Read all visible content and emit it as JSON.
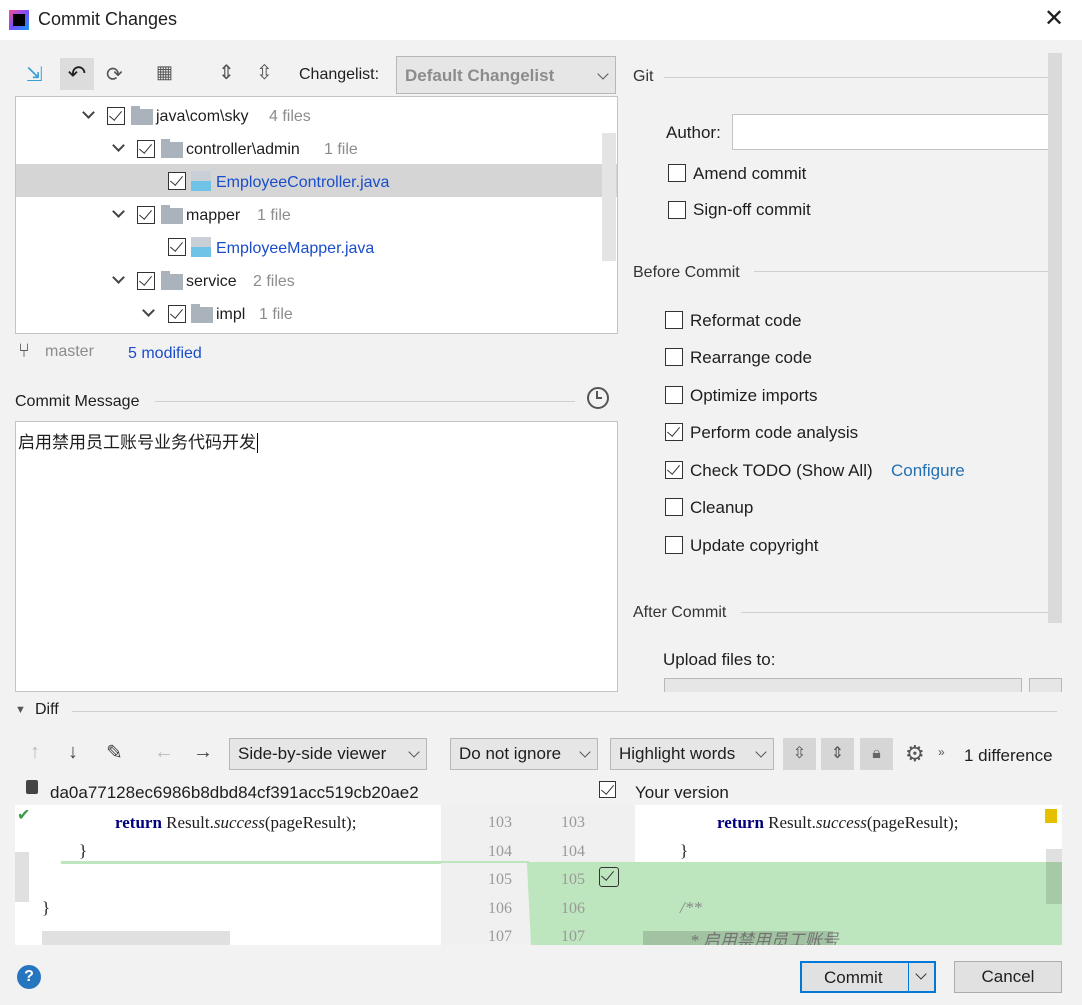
{
  "window": {
    "title": "Commit Changes"
  },
  "toolbar": {
    "changelist_label": "Changelist:",
    "changelist_value": "Default Changelist"
  },
  "tree": {
    "rows": [
      {
        "name": "java\\com\\sky",
        "count": "4 files",
        "type": "folder"
      },
      {
        "name": "controller\\admin",
        "count": "1 file",
        "type": "folder"
      },
      {
        "name": "EmployeeController.java",
        "type": "file",
        "selected": true
      },
      {
        "name": "mapper",
        "count": "1 file",
        "type": "folder"
      },
      {
        "name": "EmployeeMapper.java",
        "type": "file"
      },
      {
        "name": "service",
        "count": "2 files",
        "type": "folder"
      },
      {
        "name": "impl",
        "count": "1 file",
        "type": "folder"
      }
    ]
  },
  "status": {
    "branch": "master",
    "modified": "5 modified"
  },
  "commit_message": {
    "label": "Commit Message",
    "value": "启用禁用员工账号业务代码开发"
  },
  "git": {
    "title": "Git",
    "author_label": "Author:",
    "author_value": "",
    "amend": "Amend commit",
    "signoff": "Sign-off commit"
  },
  "before_commit": {
    "title": "Before Commit",
    "options": [
      {
        "label": "Reformat code",
        "checked": false
      },
      {
        "label": "Rearrange code",
        "checked": false
      },
      {
        "label": "Optimize imports",
        "checked": false
      },
      {
        "label": "Perform code analysis",
        "checked": true
      },
      {
        "label": "Check TODO (Show All)",
        "checked": true,
        "link": "Configure"
      },
      {
        "label": "Cleanup",
        "checked": false
      },
      {
        "label": "Update copyright",
        "checked": false
      }
    ]
  },
  "after_commit": {
    "title": "After Commit",
    "upload_label": "Upload files to:"
  },
  "diff": {
    "title": "Diff",
    "viewer": "Side-by-side viewer",
    "ignore": "Do not ignore",
    "highlight": "Highlight words",
    "differences": "1 difference",
    "left_title": "da0a77128ec6986b8dbd84cf391acc519cb20ae2",
    "right_title": "Your version",
    "line_numbers": [
      "103",
      "104",
      "105",
      "106",
      "107"
    ],
    "left_lines": {
      "l1_kw": "return",
      "l1": " Result.",
      "l1_it": "success",
      "l1_end": "(pageResult);",
      "l2": "}",
      "l4": "}"
    },
    "right_lines": {
      "l1_kw": "return",
      "l1": " Result.",
      "l1_it": "success",
      "l1_end": "(pageResult);",
      "l2": "}",
      "l4": "/**",
      "l5": "* 启用禁用员工账号"
    },
    "colors": {
      "added": "#bee6be"
    }
  },
  "buttons": {
    "commit": "Commit",
    "cancel": "Cancel",
    "help": "?"
  }
}
